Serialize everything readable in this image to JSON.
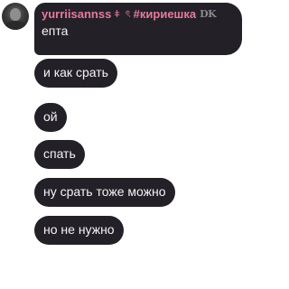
{
  "header": {
    "username": "yurriisannss",
    "separator1": "ǂ",
    "separator2": "ৎ",
    "tag": "#кириешка",
    "badge": "DK"
  },
  "messages": [
    "епта",
    "и как срать",
    "ой",
    "спать",
    "ну срать тоже можно",
    "но не нужно"
  ]
}
